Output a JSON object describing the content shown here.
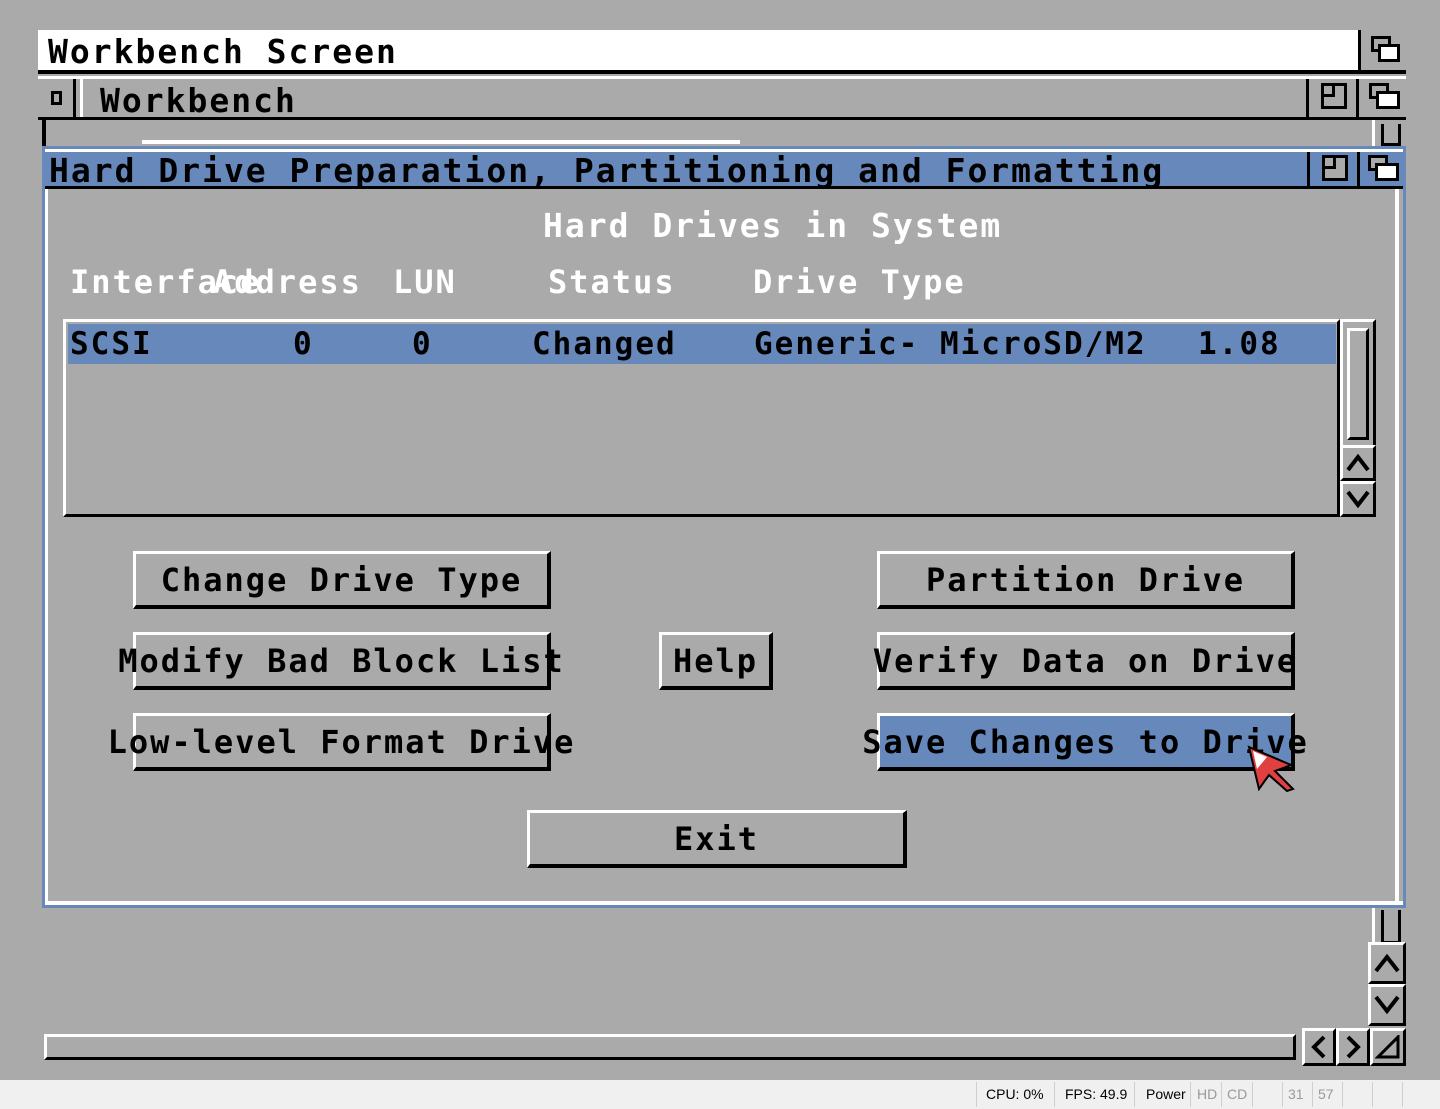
{
  "screen": {
    "title": "Workbench Screen"
  },
  "workbench_window": {
    "title": "Workbench",
    "close_glyph": "▯"
  },
  "hdtoolbox": {
    "title": "Hard Drive Preparation, Partitioning and Formatting",
    "list_heading": "Hard Drives in System",
    "columns": [
      "Interface",
      "Address",
      "LUN",
      "Status",
      "Drive Type"
    ],
    "drives": [
      {
        "interface": "SCSI",
        "address": "0",
        "lun": "0",
        "status": "Changed",
        "drive_type": "Generic- MicroSD/M2",
        "revision": "1.08",
        "selected": true
      }
    ],
    "buttons": {
      "change_drive_type": "Change Drive Type",
      "modify_bad_block_list": "Modify Bad Block List",
      "low_level_format": "Low-level Format Drive",
      "help": "Help",
      "partition_drive": "Partition Drive",
      "verify_data": "Verify Data on Drive",
      "save_changes": "Save Changes to Drive",
      "exit": "Exit"
    }
  },
  "status_bar": {
    "cpu": "CPU: 0%",
    "fps": "FPS: 49.9",
    "power": "Power",
    "hd": "HD",
    "cd": "CD",
    "val1": "31",
    "val2": "57"
  },
  "colors": {
    "background": "#aaaaaa",
    "highlight": "#6688bb",
    "white": "#ffffff",
    "black": "#000000",
    "pointer": "#e04040"
  }
}
